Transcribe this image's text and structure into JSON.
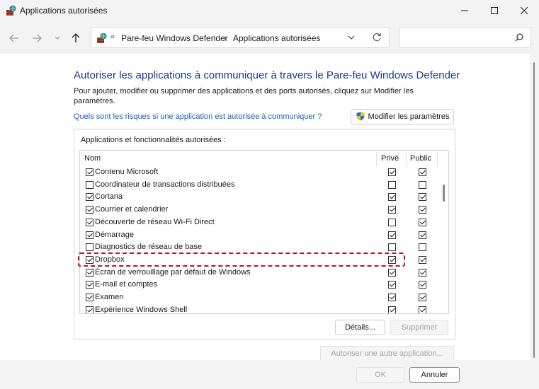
{
  "window": {
    "title": "Applications autorisées"
  },
  "address": {
    "overflow": "«",
    "crumbs": [
      "Pare-feu Windows Defender",
      "Applications autorisées"
    ],
    "separator": "›"
  },
  "search": {
    "placeholder": ""
  },
  "main": {
    "heading": "Autoriser les applications à communiquer à travers le Pare-feu Windows Defender",
    "description": "Pour ajouter, modifier ou supprimer des applications et des ports autorisés, cliquez sur Modifier les paramètres.",
    "risk_link": "Quels sont les risques si une application est autorisée à communiquer ?",
    "modify_button": "Modifier les paramètres",
    "group_label": "Applications et fonctionnalités autorisées :",
    "columns": {
      "name": "Nom",
      "private": "Privé",
      "public": "Public"
    },
    "rows": [
      {
        "name": "Contenu Microsoft",
        "enabled": true,
        "private": true,
        "public": true
      },
      {
        "name": "Coordinateur de transactions distribuées",
        "enabled": false,
        "private": false,
        "public": false
      },
      {
        "name": "Cortana",
        "enabled": true,
        "private": true,
        "public": true
      },
      {
        "name": "Courrier et calendrier",
        "enabled": true,
        "private": true,
        "public": true
      },
      {
        "name": "Découverte de réseau Wi-Fi Direct",
        "enabled": true,
        "private": false,
        "public": true
      },
      {
        "name": "Démarrage",
        "enabled": true,
        "private": true,
        "public": true
      },
      {
        "name": "Diagnostics de réseau de base",
        "enabled": false,
        "private": false,
        "public": false
      },
      {
        "name": "Dropbox",
        "enabled": true,
        "private": true,
        "public": true
      },
      {
        "name": "Écran de verrouillage par défaut de Windows",
        "enabled": true,
        "private": true,
        "public": true
      },
      {
        "name": "E-mail et comptes",
        "enabled": true,
        "private": true,
        "public": true
      },
      {
        "name": "Examen",
        "enabled": true,
        "private": true,
        "public": true
      },
      {
        "name": "Expérience Windows Shell",
        "enabled": true,
        "private": true,
        "public": true
      }
    ],
    "details_button": "Détails...",
    "delete_button": "Supprimer",
    "other_app_button": "Autoriser une autre application..."
  },
  "footer": {
    "ok": "OK",
    "cancel": "Annuler"
  },
  "colors": {
    "heading": "#1e3b8a",
    "link": "#1a5fb4",
    "highlight": "#b2142b"
  },
  "icons": [
    "firewall-app-icon",
    "back-arrow-icon",
    "forward-arrow-icon",
    "chevron-down-icon",
    "up-arrow-icon",
    "refresh-icon",
    "search-icon",
    "shield-icon"
  ]
}
